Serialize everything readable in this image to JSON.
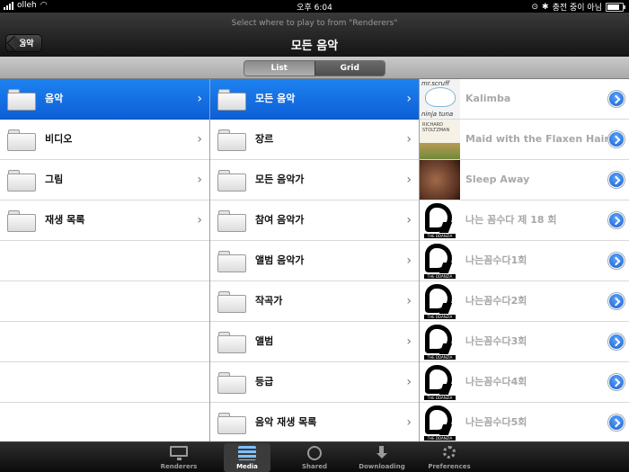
{
  "status": {
    "carrier": "olleh",
    "time": "오후 6:04",
    "charging_text": "충전 중이 아님"
  },
  "nav": {
    "prompt": "Select where to play to from \"Renderers\"",
    "title": "모든 음악",
    "back_label": "음악"
  },
  "view_toggle": {
    "options": [
      "List",
      "Grid"
    ],
    "selected": "List"
  },
  "categories": [
    {
      "label": "음악",
      "selected": true
    },
    {
      "label": "비디오",
      "selected": false
    },
    {
      "label": "그림",
      "selected": false
    },
    {
      "label": "재생 목록",
      "selected": false
    }
  ],
  "music_menu": [
    {
      "label": "모든 음악",
      "selected": true
    },
    {
      "label": "장르"
    },
    {
      "label": "모든 음악가"
    },
    {
      "label": "참여 음악가"
    },
    {
      "label": "앨범 음악가"
    },
    {
      "label": "작곡가"
    },
    {
      "label": "앨범"
    },
    {
      "label": "등급"
    },
    {
      "label": "음악 재생 목록"
    }
  ],
  "tracks": [
    {
      "title": "Kalimba",
      "art": "album-art-icon",
      "art_text_top": "mr.scruff",
      "art_text_bottom": "ninja tuna"
    },
    {
      "title": "Maid with the Flaxen Hair",
      "art": "album-art-icon",
      "art_text_top": "RICHARD STOLTZMAN"
    },
    {
      "title": "Sleep Away",
      "art": "album-art-icon",
      "art_text_top": ""
    },
    {
      "title": "나는 꼼수다 제 18 회",
      "art": "podcast-logo-icon",
      "art_text_bottom": "THE DDANZIA"
    },
    {
      "title": "나는꼼수다1회",
      "art": "podcast-logo-icon",
      "art_text_bottom": "THE DDANZIA"
    },
    {
      "title": "나는꼼수다2회",
      "art": "podcast-logo-icon",
      "art_text_bottom": "THE DDANZIA"
    },
    {
      "title": "나는꼼수다3회",
      "art": "podcast-logo-icon",
      "art_text_bottom": "THE DDANZIA"
    },
    {
      "title": "나는꼼수다4회",
      "art": "podcast-logo-icon",
      "art_text_bottom": "THE DDANZIA"
    },
    {
      "title": "나는꼼수다5회",
      "art": "podcast-logo-icon",
      "art_text_bottom": "THE DDANZIA"
    }
  ],
  "tabs": [
    {
      "label": "Renderers",
      "icon": "monitor-icon",
      "active": false
    },
    {
      "label": "Media",
      "icon": "media-icon",
      "active": true
    },
    {
      "label": "Shared",
      "icon": "shared-globe-icon",
      "active": false
    },
    {
      "label": "Downloading",
      "icon": "download-icon",
      "active": false
    },
    {
      "label": "Preferences",
      "icon": "gear-icon",
      "active": false
    }
  ],
  "colors": {
    "selection_blue": "#1a76ec",
    "disclosure_blue": "#2a7ae8",
    "track_text": "#a8a8a8"
  }
}
